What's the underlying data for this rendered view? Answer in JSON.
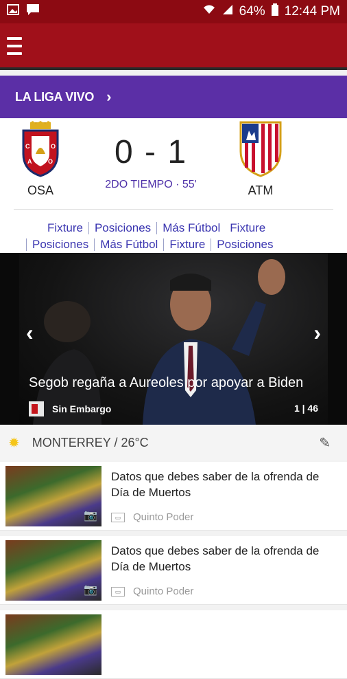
{
  "status": {
    "battery": "64%",
    "time": "12:44 PM"
  },
  "header": {
    "liga_label": "LA LIGA VIVO"
  },
  "match": {
    "home_team": "OSA",
    "away_team": "ATM",
    "score": "0 - 1",
    "period": "2DO TIEMPO · 55'"
  },
  "links": {
    "row1": [
      "Fixture",
      "Posiciones",
      "Más Fútbol",
      "Fixture"
    ],
    "row2": [
      "Posiciones",
      "Más Fútbol",
      "Fixture",
      "Posiciones"
    ]
  },
  "hero": {
    "title": "Segob regaña a Aureoles por apoyar a Biden",
    "source": "Sin Embargo",
    "counter": "1 | 46"
  },
  "weather": {
    "text": "MONTERREY / 26°C"
  },
  "articles": [
    {
      "title": "Datos que debes saber de la ofrenda de Día de Muertos",
      "source": "Quinto Poder"
    },
    {
      "title": "Datos que debes saber de la ofrenda de Día de Muertos",
      "source": "Quinto Poder"
    }
  ],
  "colors": {
    "status_bar": "#8c0a12",
    "app_bar": "#a0101a",
    "liga_banner": "#5b2fa6",
    "link_blue": "#3a35b0"
  }
}
